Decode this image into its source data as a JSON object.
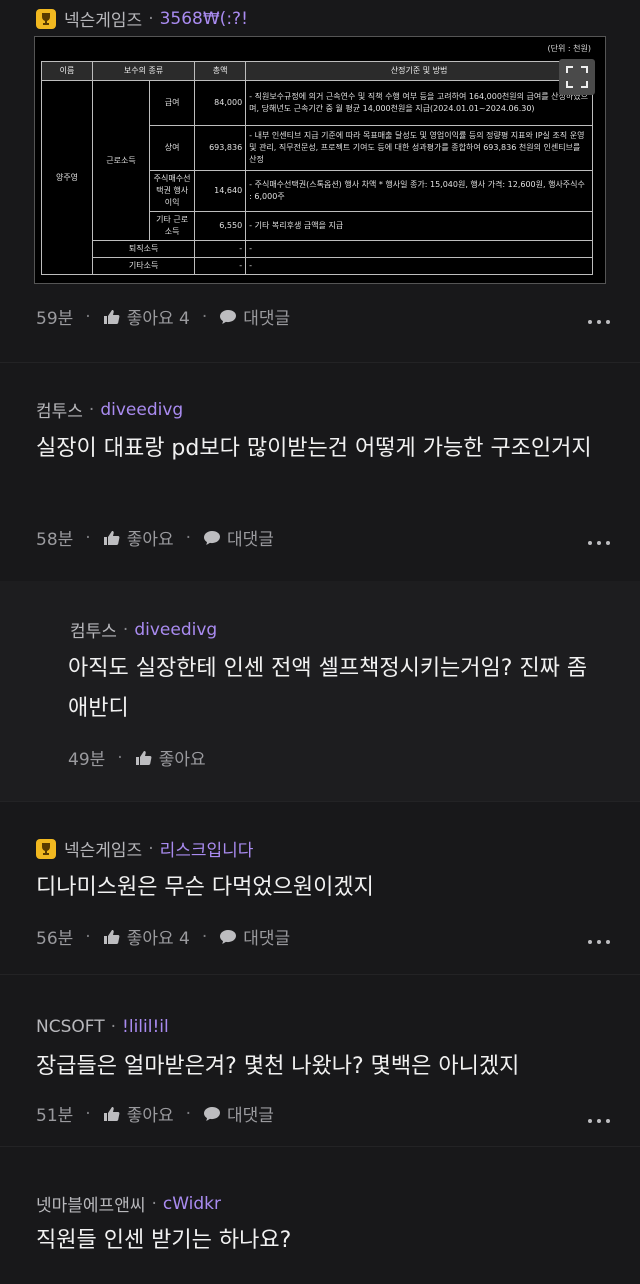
{
  "colors": {
    "background": "#18181a",
    "nickname": "#a98bf0",
    "badge": "#f1b820"
  },
  "comments": [
    {
      "company": "넥슨게임즈",
      "nickname": "3568₩(:?!",
      "has_badge": true,
      "time": "59분",
      "like_label": "좋아요 4",
      "reply_label": "대댓글",
      "table": {
        "unit": "(단위 : 천원)",
        "headers": [
          "이름",
          "보수의 종류",
          "총액",
          "산정기준 및 방법"
        ],
        "name": "양주영",
        "group": "근로소득",
        "rows": [
          {
            "type": "급여",
            "amount": "84,000",
            "method": "- 직원보수규정에 의거 근속연수 및 직책 수행 여부 등을 고려하여 164,000천원의 급여를 산정하였으며, 당해년도 근속기간 중 월 평균 14,000천원을 지급(2024.01.01~2024.06.30)"
          },
          {
            "type": "상여",
            "amount": "693,836",
            "method": "- 내부 인센티브 지급 기준에 따라 목표매출 달성도 및 영업이익률 등의 정량평 지표와 IP실 조직 운영 및 관리, 직무전문성, 프로젝트 기여도 등에 대한 성과평가를 종합하여 693,836 천원의 인센티브를 산정"
          },
          {
            "type": "주식매수선택권 행사이익",
            "amount": "14,640",
            "method": "- 주식매수선택권(스톡옵션) 행사 차액 * 행사일 종가: 15,040원, 행사 가격: 12,600원, 행사주식수 : 6,000주"
          },
          {
            "type": "기타 근로소득",
            "amount": "6,550",
            "method": "- 기타 복리후생 금액을 지급"
          }
        ],
        "extra_rows": [
          {
            "type": "퇴직소득",
            "amount": "-",
            "method": "-"
          },
          {
            "type": "기타소득",
            "amount": "-",
            "method": "-"
          }
        ]
      }
    },
    {
      "company": "컴투스",
      "nickname": "diveedivg",
      "text": "실장이 대표랑 pd보다 많이받는건 어떻게 가능한 구조인거지",
      "time": "58분",
      "like_label": "좋아요",
      "reply_label": "대댓글"
    },
    {
      "company": "컴투스",
      "nickname": "diveedivg",
      "text": "아직도 실장한테 인센 전액 셀프책정시키는거임? 진짜 좀 애반디",
      "time": "49분",
      "like_label": "좋아요"
    },
    {
      "company": "넥슨게임즈",
      "nickname": "리스크입니다",
      "has_badge": true,
      "text": "디나미스원은 무슨 다먹었으원이겠지",
      "time": "56분",
      "like_label": "좋아요 4",
      "reply_label": "대댓글"
    },
    {
      "company": "NCSOFT",
      "nickname": "!lilil!il",
      "text": "장급들은 얼마받은겨? 몇천 나왔나? 몇백은 아니겠지",
      "time": "51분",
      "like_label": "좋아요",
      "reply_label": "대댓글"
    },
    {
      "company": "넷마블에프앤씨",
      "nickname": "cWidkr",
      "text": "직원들 인센 받기는 하나요?"
    }
  ]
}
